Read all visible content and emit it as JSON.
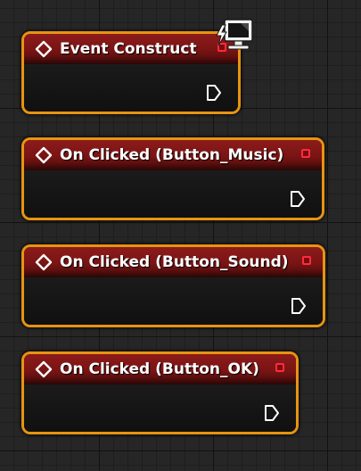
{
  "graph": {
    "nodes": [
      {
        "title": "Event Construct",
        "has_delegate_pin": true,
        "has_exec_pin": true
      },
      {
        "title": "On Clicked (Button_Music)",
        "has_delegate_pin": true,
        "has_exec_pin": true
      },
      {
        "title": "On Clicked (Button_Sound)",
        "has_delegate_pin": true,
        "has_exec_pin": true
      },
      {
        "title": "On Clicked (Button_OK)",
        "has_delegate_pin": true,
        "has_exec_pin": true
      }
    ],
    "colors": {
      "selection_outline": "#e69412",
      "event_header": "#8d1b1b",
      "delegate_pin": "#ff2c3a",
      "exec_pin": "#ffffff",
      "graph_background": "#262626"
    },
    "icons": {
      "event": "event-diamond-icon",
      "delegate": "delegate-pin-icon",
      "exec": "exec-pin-icon",
      "replication": "client-replicated-icon"
    }
  }
}
